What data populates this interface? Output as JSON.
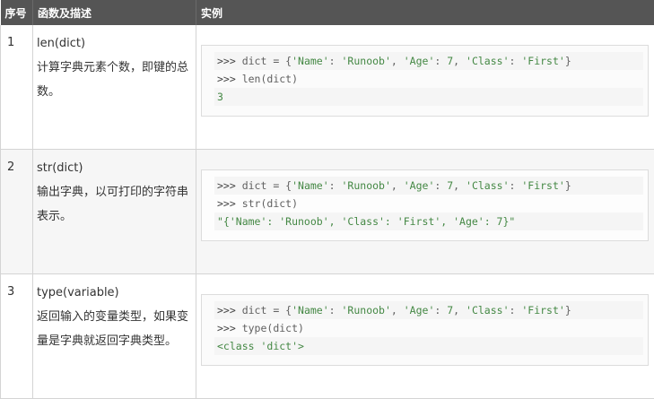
{
  "header": {
    "col_index": "序号",
    "col_desc": "函数及描述",
    "col_example": "实例"
  },
  "rows": [
    {
      "index": "1",
      "func": "len(dict)",
      "desc": "计算字典元素个数，即键的总数。",
      "code": [
        {
          "prompt": ">>> ",
          "pre": "dict = {",
          "s1": "'Name'",
          "c1": ": ",
          "s2": "'Runoob'",
          "c2": ", ",
          "s3": "'Age'",
          "c3": ": ",
          "n1": "7",
          "c4": ", ",
          "s4": "'Class'",
          "c5": ": ",
          "s5": "'First'",
          "post": "}"
        },
        {
          "prompt": ">>> ",
          "text": "len(dict)"
        }
      ],
      "output": "3"
    },
    {
      "index": "2",
      "func": "str(dict)",
      "desc": "输出字典，以可打印的字符串表示。",
      "code": [
        {
          "prompt": ">>> ",
          "pre": "dict = {",
          "s1": "'Name'",
          "c1": ": ",
          "s2": "'Runoob'",
          "c2": ", ",
          "s3": "'Age'",
          "c3": ": ",
          "n1": "7",
          "c4": ", ",
          "s4": "'Class'",
          "c5": ": ",
          "s5": "'First'",
          "post": "}"
        },
        {
          "prompt": ">>> ",
          "text": "str(dict)"
        }
      ],
      "output": "\"{'Name': 'Runoob', 'Class': 'First', 'Age': 7}\""
    },
    {
      "index": "3",
      "func": "type(variable)",
      "desc": "返回输入的变量类型，如果变量是字典就返回字典类型。",
      "code": [
        {
          "prompt": ">>> ",
          "pre": "dict = {",
          "s1": "'Name'",
          "c1": ": ",
          "s2": "'Runoob'",
          "c2": ", ",
          "s3": "'Age'",
          "c3": ": ",
          "n1": "7",
          "c4": ", ",
          "s4": "'Class'",
          "c5": ": ",
          "s5": "'First'",
          "post": "}"
        },
        {
          "prompt": ">>> ",
          "text": "type(dict)"
        }
      ],
      "output_pre": "<class ",
      "output_str": "'dict'",
      "output_post": ">"
    }
  ]
}
